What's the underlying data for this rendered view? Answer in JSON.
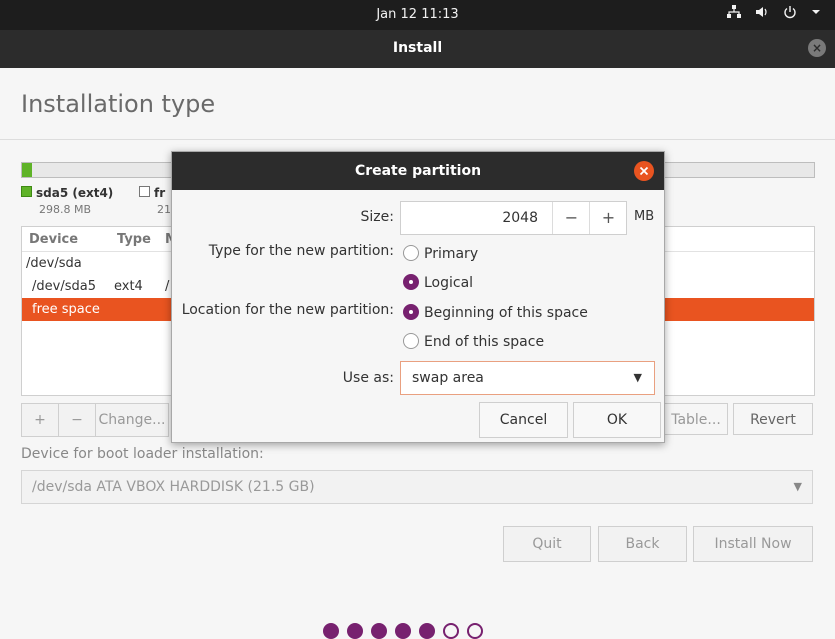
{
  "topbar": {
    "clock": "Jan 12  11:13",
    "tray_icons": [
      "network-icon",
      "volume-icon",
      "power-icon",
      "chevron-down-icon"
    ]
  },
  "window": {
    "title": "Install",
    "close_glyph": "×"
  },
  "page": {
    "title": "Installation type"
  },
  "partitions": {
    "legend": [
      {
        "name": "sda5 (ext4)",
        "size": "298.8 MB"
      },
      {
        "name": "fr",
        "size": "21"
      }
    ],
    "columns": [
      "Device",
      "Type",
      "M"
    ],
    "rows": [
      {
        "device": "/dev/sda",
        "type": "",
        "mount": ""
      },
      {
        "device": "/dev/sda5",
        "type": "ext4",
        "mount": "/"
      },
      {
        "device": "free space",
        "type": "",
        "mount": ""
      }
    ],
    "buttons": {
      "add": "+",
      "remove": "−",
      "change": "Change...",
      "new_table": "Table...",
      "revert": "Revert"
    }
  },
  "bootloader": {
    "label": "Device for boot loader installation:",
    "value": "/dev/sda   ATA VBOX HARDDISK (21.5 GB)"
  },
  "nav": {
    "quit": "Quit",
    "back": "Back",
    "install": "Install Now"
  },
  "progress": {
    "total": 7,
    "filled": 5
  },
  "dialog": {
    "title": "Create partition",
    "size_label": "Size:",
    "size_value": "2048",
    "size_unit": "MB",
    "minus": "−",
    "plus": "+",
    "type_label": "Type for the new partition:",
    "type_primary": "Primary",
    "type_logical": "Logical",
    "location_label": "Location for the new partition:",
    "loc_begin": "Beginning of this space",
    "loc_end": "End of this space",
    "useas_label": "Use as:",
    "useas_value": "swap area",
    "cancel": "Cancel",
    "ok": "OK"
  },
  "colors": {
    "accent": "#e95420",
    "aubergine": "#77216f",
    "used": "#5fb328"
  }
}
